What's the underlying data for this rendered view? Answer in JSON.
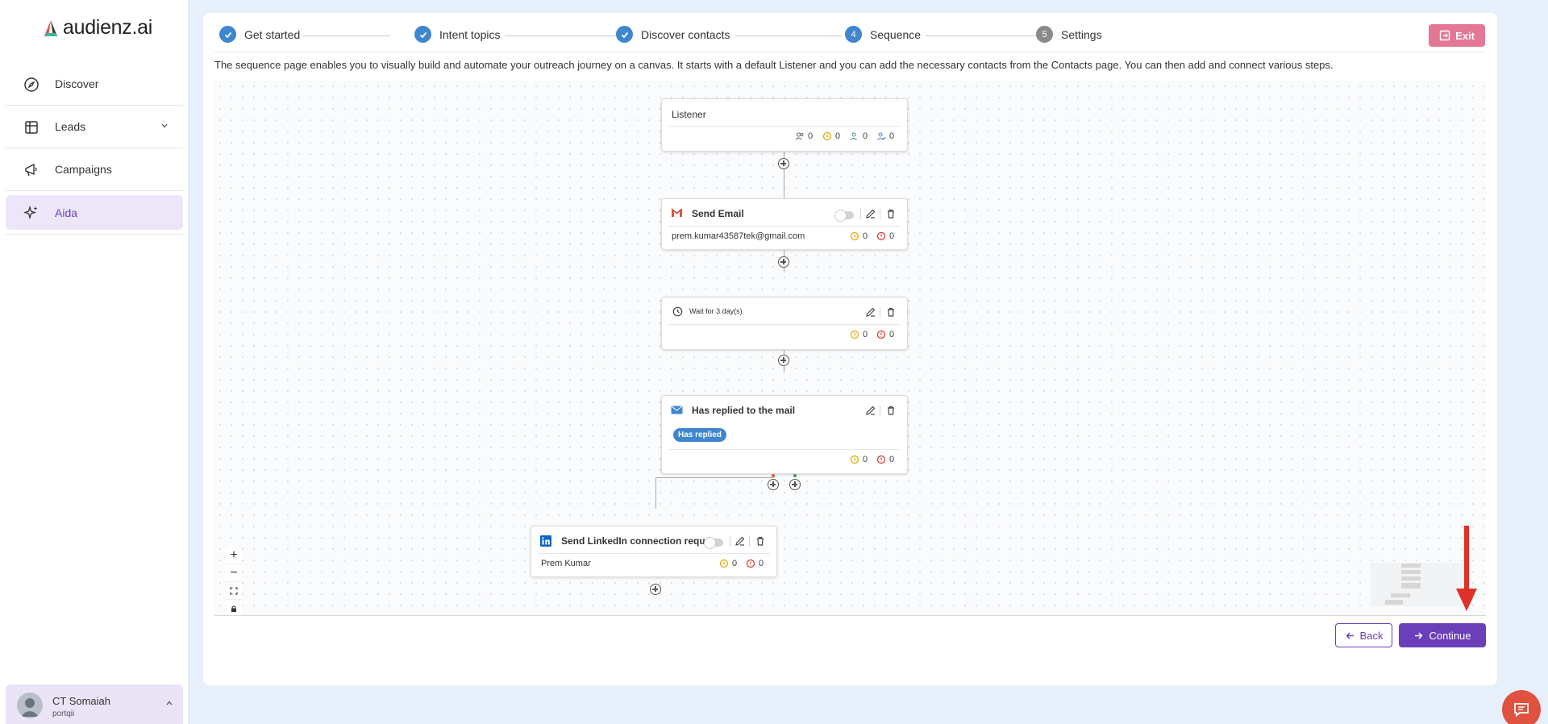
{
  "app": {
    "logo_text": "audienz.ai"
  },
  "sidebar": {
    "items": [
      {
        "label": "Discover",
        "icon": "compass-icon"
      },
      {
        "label": "Leads",
        "icon": "table-icon"
      },
      {
        "label": "Campaigns",
        "icon": "megaphone-icon"
      },
      {
        "label": "Aida",
        "icon": "sparkle-icon"
      }
    ],
    "user": {
      "name": "CT Somaiah",
      "org": "portqii"
    }
  },
  "stepper": {
    "steps": [
      {
        "label": "Get started",
        "state": "done"
      },
      {
        "label": "Intent topics",
        "state": "done"
      },
      {
        "label": "Discover contacts",
        "state": "done"
      },
      {
        "label": "Sequence",
        "state": "current",
        "number": "4"
      },
      {
        "label": "Settings",
        "state": "pending",
        "number": "5"
      }
    ],
    "exit_label": "Exit"
  },
  "description": "The sequence page enables you to visually build and automate your outreach journey on a canvas. It starts with a default Listener and you can add the necessary contacts from the Contacts page. You can then add and connect various steps.",
  "canvas": {
    "listener": {
      "title": "Listener",
      "counts": [
        "0",
        "0",
        "0",
        "0"
      ]
    },
    "send_email": {
      "title": "Send Email",
      "email": "prem.kumar43587tek@gmail.com",
      "pending": "0",
      "error": "0"
    },
    "wait": {
      "title": "Wait for 3 day(s)",
      "pending": "0",
      "error": "0"
    },
    "condition": {
      "title": "Has replied to the mail",
      "badge": "Has replied",
      "pending": "0",
      "error": "0"
    },
    "linkedin": {
      "title": "Send LinkedIn connection requ...",
      "contact": "Prem Kumar",
      "pending": "0",
      "error": "0"
    },
    "zoom": {
      "in": "+",
      "out": "−"
    }
  },
  "footer": {
    "back_label": "Back",
    "continue_label": "Continue"
  },
  "colors": {
    "accent": "#6a3fb8",
    "step_done": "#3f86d0",
    "exit": "#e37896",
    "chat": "#e0513f"
  }
}
